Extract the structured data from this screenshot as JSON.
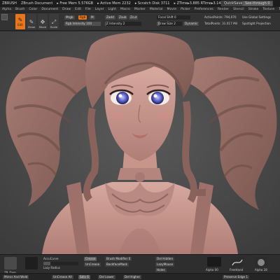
{
  "titlebar": {
    "items": [
      "ZBRUSH",
      "ZBrush Document",
      "▸ Free Mem 5.576GB",
      "▸ Active Mem 2232",
      "▸ Scratch Disk 3711",
      "▸ ZTime▸3.885 RTime▸3.144 Timer▸1"
    ],
    "quicksave": "QuickSave",
    "seethrough": "See-through 0"
  },
  "menubar": {
    "items": [
      "Alpha",
      "Brush",
      "Color",
      "Document",
      "Draw",
      "Edit",
      "File",
      "Layer",
      "Light",
      "Macro",
      "Marker",
      "Material",
      "Movie",
      "Picker",
      "Preferences",
      "Render",
      "Stencil",
      "Stroke",
      "Texture",
      "Tool",
      "Transform",
      "Zplugin",
      "Zscript"
    ]
  },
  "shelf": {
    "edit_label": "Edit",
    "tools": [
      {
        "label": "Draw",
        "icon": "✎"
      },
      {
        "label": "Move",
        "icon": "✥"
      },
      {
        "label": "Scale",
        "icon": "⤢"
      },
      {
        "label": "Rotate",
        "icon": "⟳"
      }
    ],
    "mrgb": "Mrgb",
    "rgb": "Rgb",
    "m": "M",
    "rgb_intensity": "Rgb Intensity 100",
    "zadd": "Zadd",
    "zsub": "Zsub",
    "zcut": "Zcut",
    "z_intensity": "Z Intensity 2",
    "focal_shift": "Focal Shift 0",
    "draw_size": "Draw Size 2",
    "dynamic": "Dynamic",
    "active_points": "ActivePoints: 794,070",
    "total_points": "TotalPoints: 31.017 Mil",
    "spotlight": "Spotlight Projection",
    "use_global": "Use Global Settings",
    "focal_shift_value": 0,
    "draw_size_fill": 0.12,
    "rgb_intensity_fill": 1.0,
    "z_intensity_fill": 0.04
  },
  "tray": {
    "brush_label": "ZB_Dam",
    "alpha_label": "Alpha 00",
    "freehand_label": "FreeHand",
    "alpha2_label": "Alpha 28",
    "accucurve": "AccuCurve",
    "curve_label": "Curve Falloff",
    "laz_label": "Lazy Radius",
    "crease": "Crease",
    "uncrease": "UnCrease",
    "brush_modifier": "Brush Modifier 0",
    "backface": "BackfaceMask",
    "dot_hidden": "Del Hidden",
    "lazymouse": "LazyMouse",
    "holes": "Holes",
    "mirror": "Mirror And Weld",
    "undo_all": "UnCrease All",
    "sdiv": "Sdiv 6",
    "dellower": "Del Lower",
    "delhigher": "Del Higher",
    "preserve": "Preserve Edge 1",
    "colors": {
      "brush_swatch": "#4a4a4a",
      "alpha_swatch": "#1e1e1e",
      "accent": "#e8761c"
    }
  }
}
